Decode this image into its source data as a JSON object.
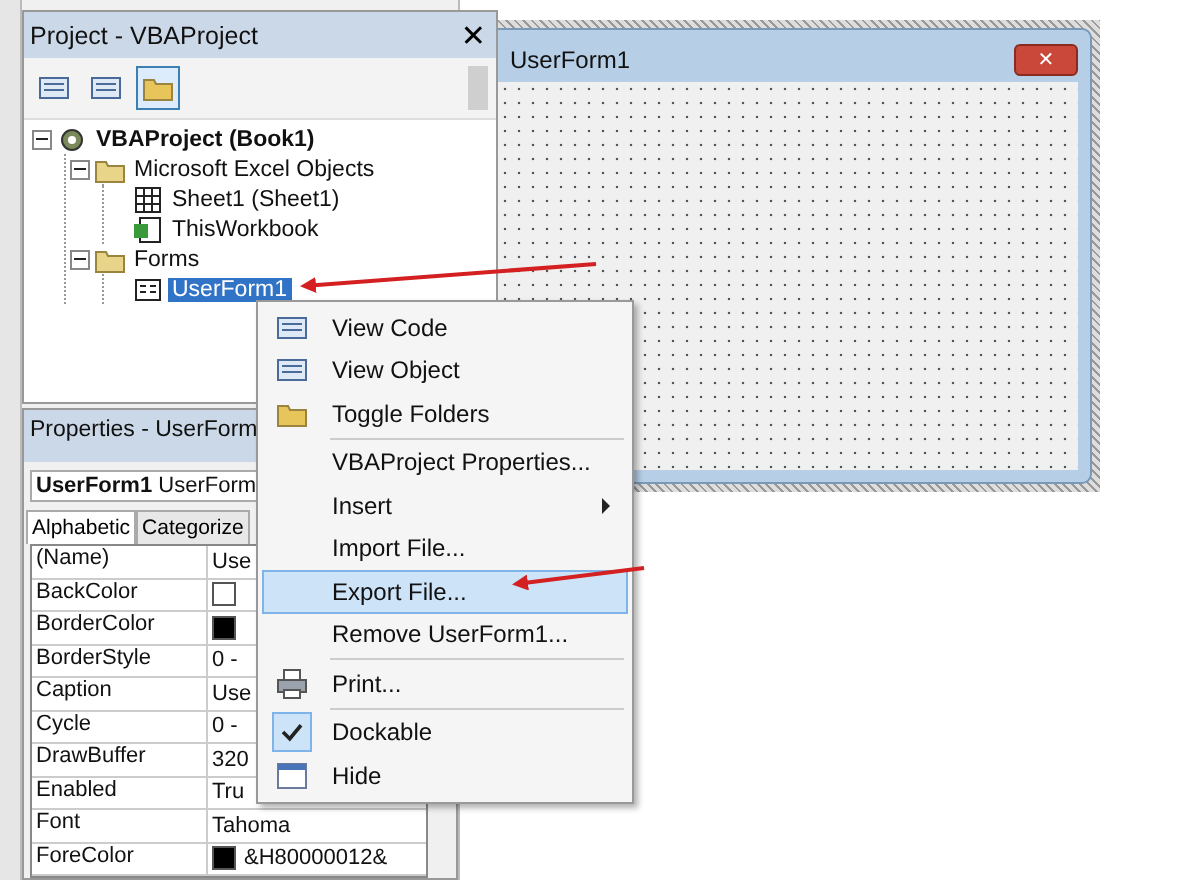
{
  "project_pane": {
    "title": "Project - VBAProject",
    "close": "✕",
    "toolbar": [
      {
        "selected": false
      },
      {
        "selected": false
      },
      {
        "selected": true
      }
    ],
    "tree": [
      {
        "label": "VBAProject (Book1)",
        "kind": "project",
        "expanded": true,
        "selected": false,
        "children": [
          {
            "label": "Microsoft Excel Objects",
            "kind": "folder",
            "expanded": true,
            "selected": false,
            "children": [
              {
                "label": "Sheet1 (Sheet1)",
                "kind": "sheet",
                "selected": false
              },
              {
                "label": "ThisWorkbook",
                "kind": "workbook",
                "selected": false
              }
            ]
          },
          {
            "label": "Forms",
            "kind": "folder",
            "expanded": true,
            "selected": false,
            "children": [
              {
                "label": "UserForm1",
                "kind": "form",
                "selected": true
              }
            ]
          }
        ]
      }
    ]
  },
  "properties_pane": {
    "title": "Properties - UserForm",
    "object": "UserForm1",
    "object_type": "UserForm",
    "tabs": [
      {
        "label": "Alphabetic",
        "selected": true
      },
      {
        "label": "Categorize",
        "selected": false
      }
    ],
    "rows": [
      {
        "name": "(Name)",
        "value": "Use"
      },
      {
        "name": "BackColor",
        "color": "#ffffff"
      },
      {
        "name": "BorderColor",
        "color": "#000000"
      },
      {
        "name": "BorderStyle",
        "value": "0 -"
      },
      {
        "name": "Caption",
        "value": "Use"
      },
      {
        "name": "Cycle",
        "value": "0 -"
      },
      {
        "name": "DrawBuffer",
        "value": "320"
      },
      {
        "name": "Enabled",
        "value": "Tru"
      },
      {
        "name": "Font",
        "value": "Tahoma"
      },
      {
        "name": "ForeColor",
        "color": "#000000",
        "value": "&H80000012&"
      }
    ]
  },
  "designer": {
    "form_title": "UserForm1",
    "close": "✕"
  },
  "context_menu": {
    "items": [
      {
        "kind": "icon",
        "label": "View Code",
        "selected": false
      },
      {
        "kind": "icon",
        "label": "View Object",
        "selected": false
      },
      {
        "kind": "icon",
        "label": "Toggle Folders",
        "selected": false
      },
      {
        "kind": "separator"
      },
      {
        "kind": "plain",
        "label": "VBAProject Properties...",
        "selected": false
      },
      {
        "kind": "submenu",
        "label": "Insert",
        "selected": false
      },
      {
        "kind": "plain",
        "label": "Import File...",
        "selected": false
      },
      {
        "kind": "plain",
        "label": "Export File...",
        "selected": true
      },
      {
        "kind": "plain",
        "label": "Remove UserForm1...",
        "selected": false
      },
      {
        "kind": "separator"
      },
      {
        "kind": "icon",
        "label": "Print...",
        "selected": false
      },
      {
        "kind": "separator"
      },
      {
        "kind": "check",
        "label": "Dockable",
        "checked": true,
        "selected": false
      },
      {
        "kind": "icon",
        "label": "Hide",
        "selected": false
      }
    ]
  }
}
